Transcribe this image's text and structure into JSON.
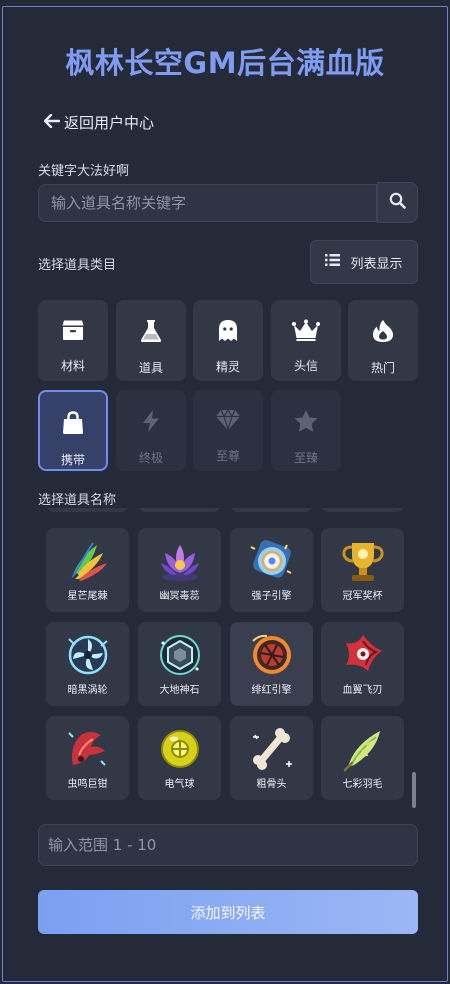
{
  "header": {
    "title": "枫林长空GM后台满血版"
  },
  "nav": {
    "back_label": "返回用户中心"
  },
  "search": {
    "label": "关键字大法好啊",
    "placeholder": "输入道具名称关键字",
    "value": ""
  },
  "category": {
    "label": "选择道具类目",
    "list_button_label": "列表显示",
    "items": [
      {
        "label": "材料",
        "icon": "box-icon",
        "state": "normal"
      },
      {
        "label": "道具",
        "icon": "flask-icon",
        "state": "normal"
      },
      {
        "label": "精灵",
        "icon": "ghost-icon",
        "state": "normal"
      },
      {
        "label": "头信",
        "icon": "crown-icon",
        "state": "normal"
      },
      {
        "label": "热门",
        "icon": "fire-icon",
        "state": "normal"
      },
      {
        "label": "携带",
        "icon": "bag-icon",
        "state": "selected"
      },
      {
        "label": "终极",
        "icon": "bolt-icon",
        "state": "disabled"
      },
      {
        "label": "至尊",
        "icon": "gem-icon",
        "state": "disabled"
      },
      {
        "label": "至臻",
        "icon": "star-icon",
        "state": "disabled"
      }
    ]
  },
  "items": {
    "label": "选择道具名称",
    "list": [
      {
        "label": "星芒尾棘",
        "icon": "feather-plume-icon"
      },
      {
        "label": "幽冥毒蕊",
        "icon": "lotus-icon"
      },
      {
        "label": "强子引擎",
        "icon": "orb-engine-icon"
      },
      {
        "label": "冠军奖杯",
        "icon": "trophy-icon"
      },
      {
        "label": "暗黑涡轮",
        "icon": "turbine-icon"
      },
      {
        "label": "大地神石",
        "icon": "hex-stone-icon"
      },
      {
        "label": "绯红引擎",
        "icon": "red-engine-icon"
      },
      {
        "label": "血翼飞刃",
        "icon": "shuriken-icon"
      },
      {
        "label": "虫鸣巨钳",
        "icon": "claw-icon"
      },
      {
        "label": "电气球",
        "icon": "electric-ball-icon"
      },
      {
        "label": "粗骨头",
        "icon": "bone-icon"
      },
      {
        "label": "七彩羽毛",
        "icon": "rainbow-feather-icon"
      }
    ]
  },
  "range": {
    "placeholder": "输入范围 1 - 10",
    "value": ""
  },
  "submit": {
    "label": "添加到列表"
  },
  "colors": {
    "accent": "#7f9cf2",
    "background": "#242938",
    "tile": "#333847",
    "selected_border": "#6f8cf0"
  }
}
